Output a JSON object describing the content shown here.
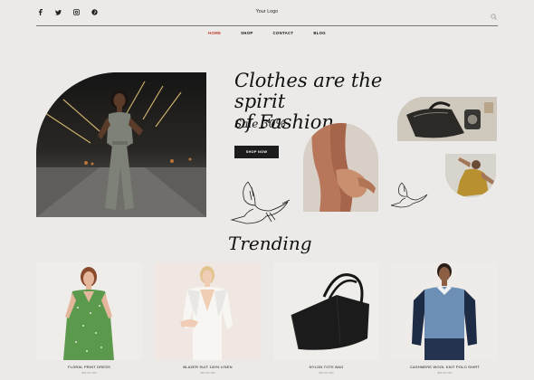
{
  "header": {
    "logo": "Your Logo",
    "social_icons": [
      "facebook-icon",
      "twitter-icon",
      "instagram-icon",
      "pinterest-icon"
    ],
    "search_icon": "search-icon"
  },
  "nav": {
    "items": [
      "HOME",
      "SHOP",
      "CONTACT",
      "BLOG"
    ],
    "active": "HOME",
    "active_color": "#c0392b"
  },
  "hero": {
    "title_line1": "Clothes are the spirit",
    "title_line2": "of Fashion.",
    "sale": "Sale 30%",
    "button": "SHOP NOW"
  },
  "trending": {
    "heading": "Trending",
    "products": [
      {
        "name": "FLORAL PRINT DRESS",
        "price": "$52.00 USD"
      },
      {
        "name": "BLAZER SUIT 100% LINEN",
        "price": "$52.00 USD"
      },
      {
        "name": "NYLON TOTE BAG",
        "price": "$52.00 USD"
      },
      {
        "name": "CASHMERE WOOL KNIT POLO SHIRT",
        "price": "$52.00 USD"
      }
    ]
  }
}
